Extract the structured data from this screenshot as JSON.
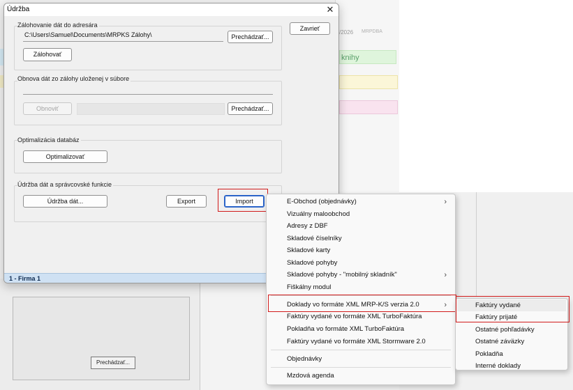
{
  "background": {
    "date_fragment": "/2026",
    "code_fragment": "MRPDBA",
    "green_row_label": "knihy",
    "browse_button_fragment": "Prechádzať..."
  },
  "dialog": {
    "title": "Údržba",
    "close_button": "✕",
    "close_label": "Zavrieť",
    "backup": {
      "group_label": "Zálohovanie dát do adresára",
      "path": "C:\\Users\\Samuel\\Documents\\MRPKS Zálohy\\",
      "browse_label": "Prechádzať...",
      "backup_button": "Zálohovať"
    },
    "restore": {
      "group_label": "Obnova dát zo zálohy uloženej v súbore",
      "file_value": "",
      "restore_button": "Obnoviť",
      "browse_label": "Prechádzať..."
    },
    "optimize": {
      "group_label": "Optimalizácia databáz",
      "optimize_button": "Optimalizovať"
    },
    "maintenance": {
      "group_label": "Údržba dát a správcovské funkcie",
      "maintenance_button": "Údržba dát...",
      "export_button": "Export",
      "import_button": "Import"
    },
    "status": "1 - Firma 1"
  },
  "context_menu": {
    "items": [
      {
        "label": "E-Obchod (objednávky)",
        "has_submenu": true
      },
      {
        "label": "Vizuálny maloobchod",
        "has_submenu": false
      },
      {
        "label": "Adresy z DBF",
        "has_submenu": false
      },
      {
        "label": "Skladové číselníky",
        "has_submenu": false
      },
      {
        "label": "Skladové karty",
        "has_submenu": false
      },
      {
        "label": "Skladové pohyby",
        "has_submenu": false
      },
      {
        "label": "Skladové pohyby - \"mobilný skladník\"",
        "has_submenu": true
      },
      {
        "label": "Fiškálny modul",
        "has_submenu": false
      },
      {
        "label": "Doklady vo formáte XML MRP-K/S verzia 2.0",
        "has_submenu": true
      },
      {
        "label": "Faktúry vydané vo formáte XML TurboFaktúra",
        "has_submenu": false
      },
      {
        "label": "Pokladňa vo formáte XML TurboFaktúra",
        "has_submenu": false
      },
      {
        "label": "Faktúry vydané vo formáte XML Stormware 2.0",
        "has_submenu": false
      },
      {
        "label": "Objednávky",
        "has_submenu": false
      },
      {
        "label": "Mzdová agenda",
        "has_submenu": false
      }
    ],
    "submenu_arrow": "›"
  },
  "submenu": {
    "items": [
      {
        "label": "Faktúry vydané"
      },
      {
        "label": "Faktúry prijaté"
      },
      {
        "label": "Ostatné pohľadávky"
      },
      {
        "label": "Ostatné záväzky"
      },
      {
        "label": "Pokladňa"
      },
      {
        "label": "Interné doklady"
      }
    ]
  },
  "colors": {
    "highlight_outline": "#d11a1a",
    "status_bar": "#cfe1f3",
    "focus_border": "#2a64c9"
  }
}
